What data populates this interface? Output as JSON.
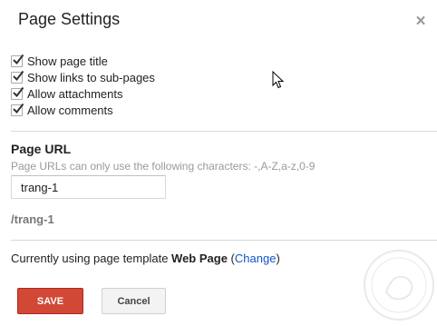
{
  "dialog": {
    "title": "Page Settings",
    "close_symbol": "×"
  },
  "options": [
    {
      "label": "Show page title",
      "checked": true
    },
    {
      "label": "Show links to sub-pages",
      "checked": true
    },
    {
      "label": "Allow attachments",
      "checked": true
    },
    {
      "label": "Allow comments",
      "checked": true
    }
  ],
  "page_url": {
    "label": "Page URL",
    "hint": "Page URLs can only use the following characters: -,A-Z,a-z,0-9",
    "value": "trang-1",
    "path": "/trang-1"
  },
  "template": {
    "prefix": "Currently using page template ",
    "name": "Web Page",
    "open_paren": " (",
    "change_link": "Change",
    "close_paren": ")"
  },
  "buttons": {
    "save": "SAVE",
    "cancel": "Cancel"
  },
  "colors": {
    "save_button": "#d14836",
    "link": "#1155cc",
    "hint": "#9a9a9a"
  }
}
